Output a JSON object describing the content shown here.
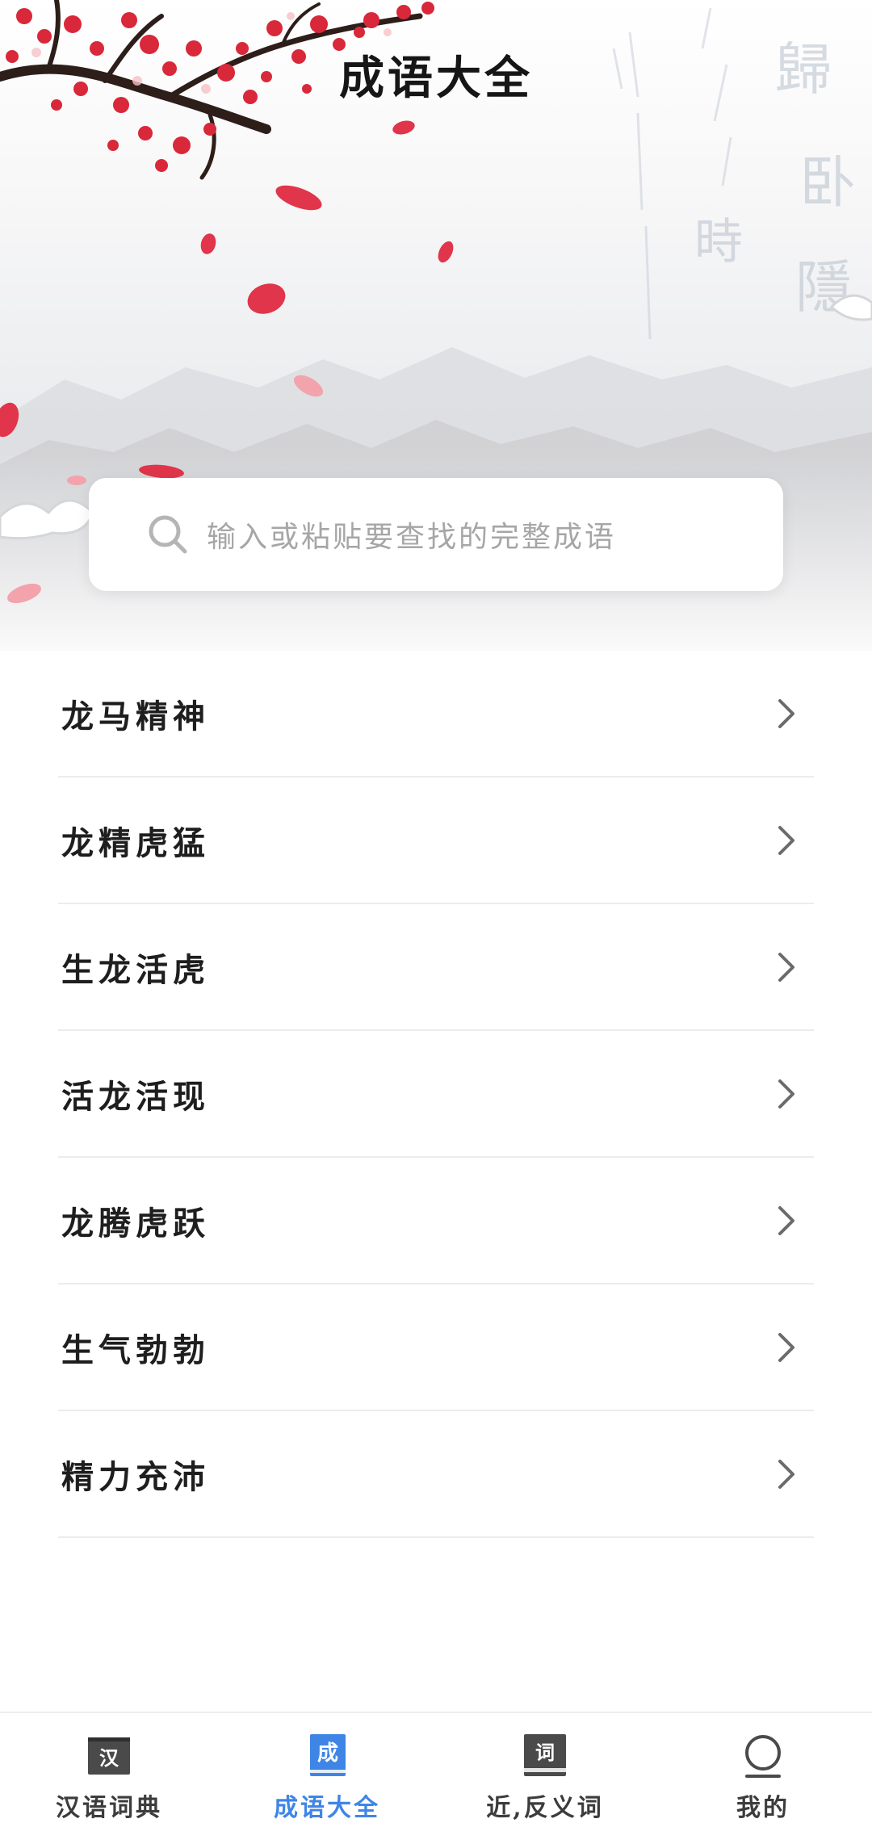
{
  "header": {
    "title": "成语大全"
  },
  "search": {
    "placeholder": "输入或粘贴要查找的完整成语",
    "icon": "search-icon"
  },
  "idioms": [
    "龙马精神",
    "龙精虎猛",
    "生龙活虎",
    "活龙活现",
    "龙腾虎跃",
    "生气勃勃",
    "精力充沛"
  ],
  "bottom_nav": {
    "items": [
      {
        "label": "汉语词典",
        "icon_text": "汉",
        "icon": "dictionary-icon",
        "active": false
      },
      {
        "label": "成语大全",
        "icon_text": "成",
        "icon": "idiom-book-icon",
        "active": true
      },
      {
        "label": "近,反义词",
        "icon_text": "词",
        "icon": "synonym-book-icon",
        "active": false
      },
      {
        "label": "我的",
        "icon_text": "",
        "icon": "profile-icon",
        "active": false
      }
    ]
  },
  "colors": {
    "accent": "#3f85e6",
    "text": "#1e1e1e",
    "placeholder": "#a6a6a6",
    "divider": "#ececec",
    "blossom": "#d8283a"
  }
}
